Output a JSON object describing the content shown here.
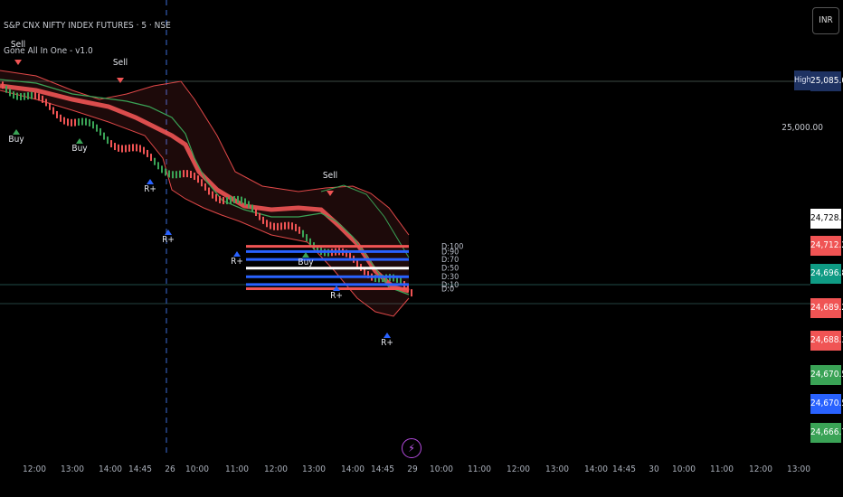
{
  "header": {
    "title": "S&P CNX NIFTY INDEX FUTURES · 5 · NSE",
    "indicator": "Gone All In One - v1.0"
  },
  "currency_button": "INR",
  "high_label": "High",
  "zoom_icon": "bolt-icon",
  "y_axis_labels": [
    "25,000.00"
  ],
  "price_tags": [
    {
      "value": "25,085.00",
      "color": "#1e3262"
    },
    {
      "value": "24,728.34",
      "color": "#ffffff",
      "text": "#000000"
    },
    {
      "value": "24,712.28",
      "color": "#f05454"
    },
    {
      "value": "24,696.80",
      "color": "#0f9b84"
    },
    {
      "value": "24,689.25",
      "color": "#f05454"
    },
    {
      "value": "24,688.39",
      "color": "#f05454"
    },
    {
      "value": "24,670.56",
      "color": "#3aa356"
    },
    {
      "value": "24,670.56",
      "color": "#2962ff"
    },
    {
      "value": "24,666.77",
      "color": "#3aa356"
    }
  ],
  "x_axis_labels": [
    "12:00",
    "13:00",
    "14:00",
    "14:45",
    "26",
    "10:00",
    "11:00",
    "12:00",
    "13:00",
    "14:00",
    "14:45",
    "29",
    "10:00",
    "11:00",
    "12:00",
    "13:00",
    "14:00",
    "14:45",
    "30",
    "10:00",
    "11:00",
    "12:00",
    "13:00"
  ],
  "chart_data": {
    "type": "line",
    "title": "S&P CNX NIFTY INDEX FUTURES · 5 · NSE",
    "x": [
      "12:00",
      "13:00",
      "14:00",
      "14:45",
      "26",
      "10:00",
      "11:00",
      "12:00",
      "13:00",
      "14:00",
      "14:45",
      "29"
    ],
    "series": [
      {
        "values": [
          25040,
          25020,
          25010,
          24980,
          24870,
          24780,
          24750,
          24745,
          24740,
          24730,
          24700,
          24680
        ]
      }
    ],
    "signals": [
      {
        "x": "12:00",
        "label": "Sell"
      },
      {
        "x": "12:00",
        "label": "Buy"
      },
      {
        "x": "13:00",
        "label": "Buy"
      },
      {
        "x": "13:00",
        "label": "Sell"
      },
      {
        "x": "14:45",
        "label": "R+"
      },
      {
        "x": "26",
        "label": "R+"
      },
      {
        "x": "11:00",
        "label": "R+"
      },
      {
        "x": "13:00",
        "label": "Sell"
      },
      {
        "x": "13:00",
        "label": "Buy"
      },
      {
        "x": "14:00",
        "label": "R+"
      },
      {
        "x": "14:45",
        "label": "R+"
      }
    ],
    "levels": [
      {
        "label": "D:100",
        "price": 24770,
        "color": "#f05454"
      },
      {
        "label": "D:90",
        "price": 24760,
        "color": "#2962ff"
      },
      {
        "label": "D:70",
        "price": 24745,
        "color": "#2962ff"
      },
      {
        "label": "D:50",
        "price": 24728.34,
        "color": "#ffffff"
      },
      {
        "label": "D:30",
        "price": 24712,
        "color": "#2962ff"
      },
      {
        "label": "D:10",
        "price": 24697,
        "color": "#2962ff"
      },
      {
        "label": "D:0",
        "price": 24689,
        "color": "#f05454"
      }
    ],
    "ylim": [
      24600,
      25110
    ],
    "grid": false
  }
}
